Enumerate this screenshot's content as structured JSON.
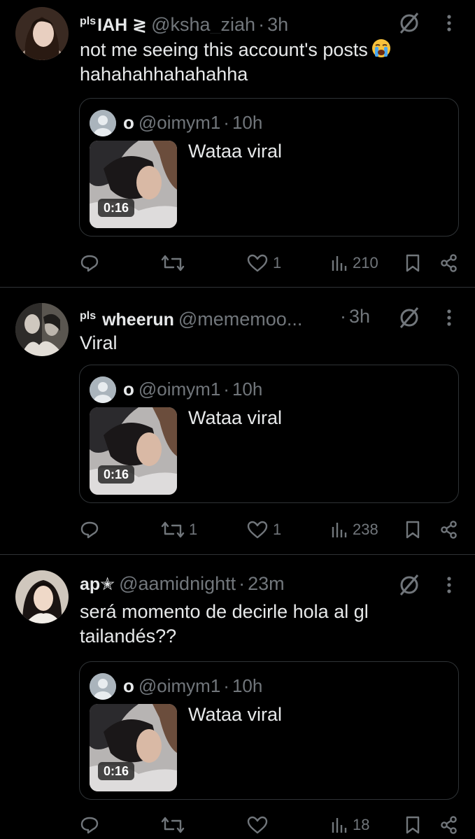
{
  "posts": [
    {
      "name_prefix": "pls",
      "name": "IAH ≷",
      "handle": "@ksha_ziah",
      "separator": "·",
      "time": "3h",
      "text": "not me seeing this account's posts",
      "text_line2": "hahahahhahahahha",
      "emoji": "loudly-crying-face-icon",
      "quote": {
        "name": "o",
        "handle": "@oimym1",
        "separator": "·",
        "time": "10h",
        "text": "Wataa viral",
        "duration": "0:16"
      },
      "actions": {
        "replies": "",
        "reposts": "",
        "likes": "1",
        "views": "210"
      }
    },
    {
      "name_prefix": "pls",
      "name": "wheerun",
      "handle": "@mememoo...",
      "separator": "·",
      "time": "3h",
      "text": "Viral",
      "text_line2": "",
      "quote": {
        "name": "o",
        "handle": "@oimym1",
        "separator": "·",
        "time": "10h",
        "text": "Wataa viral",
        "duration": "0:16"
      },
      "actions": {
        "replies": "",
        "reposts": "1",
        "likes": "1",
        "views": "238"
      }
    },
    {
      "name_prefix": "",
      "name": "ap✭",
      "handle": "@aamidnightt",
      "separator": "·",
      "time": "23m",
      "text": "será momento de decirle hola al gl",
      "text_line2": "tailandés??",
      "quote": {
        "name": "o",
        "handle": "@oimym1",
        "separator": "·",
        "time": "10h",
        "text": "Wataa viral",
        "duration": "0:16"
      },
      "actions": {
        "replies": "",
        "reposts": "",
        "likes": "",
        "views": "18"
      }
    }
  ],
  "colors": {
    "background": "#000000",
    "text": "#e7e9ea",
    "muted": "#71767b",
    "border": "#2f3336"
  }
}
